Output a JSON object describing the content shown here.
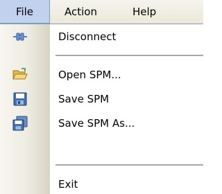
{
  "menubar": {
    "file_label": "File",
    "action_label": "Action",
    "help_label": "Help"
  },
  "file_menu": {
    "disconnect_label": "Disconnect",
    "open_spm_label": "Open SPM...",
    "save_spm_label": "Save SPM",
    "save_spm_as_label": "Save SPM As...",
    "exit_label": "Exit"
  },
  "icons": {
    "disconnect": "plug-disconnect-icon",
    "open_spm": "open-folder-icon",
    "save_spm": "floppy-disk-icon",
    "save_spm_as": "stacked-floppy-disks-icon"
  },
  "colors": {
    "menubar_background": "#ece9d8",
    "active_menu_background": "#c1d2ee",
    "menu_border": "#7f9db9",
    "separator": "#a7a6aa"
  }
}
